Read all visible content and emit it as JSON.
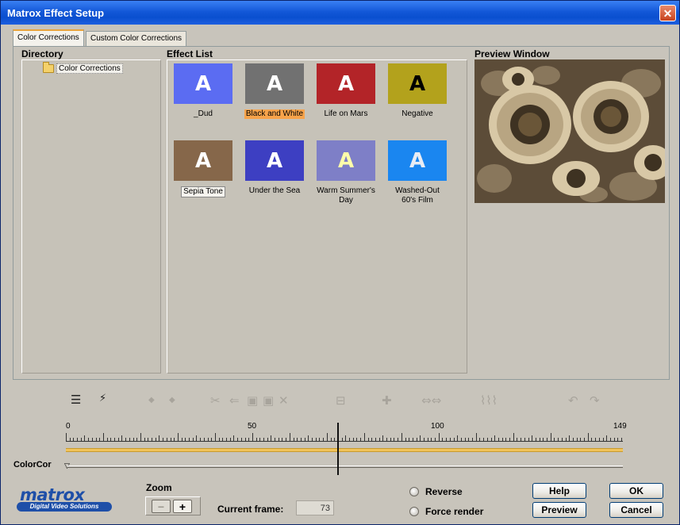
{
  "window": {
    "title": "Matrox Effect Setup",
    "close_symbol": "✕"
  },
  "tabs": [
    {
      "label": "Color Corrections",
      "active": true
    },
    {
      "label": "Custom Color Corrections",
      "active": false
    }
  ],
  "directory": {
    "heading": "Directory",
    "items": [
      {
        "label": "Color Corrections",
        "icon": "folder-icon"
      }
    ]
  },
  "effects": {
    "heading": "Effect List",
    "items": [
      {
        "label": "_Dud",
        "glyph": "A",
        "bg": "#5b6cf2",
        "fg": "#ffffff",
        "state": "normal"
      },
      {
        "label": "Black and White",
        "glyph": "A",
        "bg": "#717171",
        "fg": "#ffffff",
        "state": "selected"
      },
      {
        "label": "Life on Mars",
        "glyph": "A",
        "bg": "#b32428",
        "fg": "#ffffff",
        "state": "normal"
      },
      {
        "label": "Negative",
        "glyph": "A",
        "bg": "#b3a21c",
        "fg": "#000000",
        "state": "normal"
      },
      {
        "label": "Sepia Tone",
        "glyph": "A",
        "bg": "#86674a",
        "fg": "#ffffff",
        "state": "focused"
      },
      {
        "label": "Under the Sea",
        "glyph": "A",
        "bg": "#3d3fc2",
        "fg": "#ffffff",
        "state": "normal"
      },
      {
        "label": "Warm Summer's Day",
        "glyph": "A",
        "bg": "#7e7fc7",
        "fg": "#ffffaa",
        "state": "normal"
      },
      {
        "label": "Washed-Out 60's Film",
        "glyph": "A",
        "bg": "#1a86f0",
        "fg": "#e8ecf4",
        "state": "normal"
      }
    ]
  },
  "preview": {
    "heading": "Preview Window"
  },
  "timeline": {
    "ruler_labels": [
      "0",
      "50",
      "100",
      "149"
    ],
    "track_label": "ColorCor",
    "cursor_frame": 73
  },
  "logo": {
    "name": "matrox",
    "tagline": "Digital Video Solutions"
  },
  "zoom": {
    "label": "Zoom",
    "minus": "−",
    "plus": "+"
  },
  "current_frame": {
    "label": "Current frame:",
    "value": "73"
  },
  "options": {
    "reverse": "Reverse",
    "force_render": "Force render"
  },
  "buttons": {
    "help": "Help",
    "ok": "OK",
    "preview": "Preview",
    "cancel": "Cancel"
  },
  "colors": {
    "selection": "#f7a34a",
    "track": "#f1c35a",
    "title_bar": "#0a4fcf"
  }
}
